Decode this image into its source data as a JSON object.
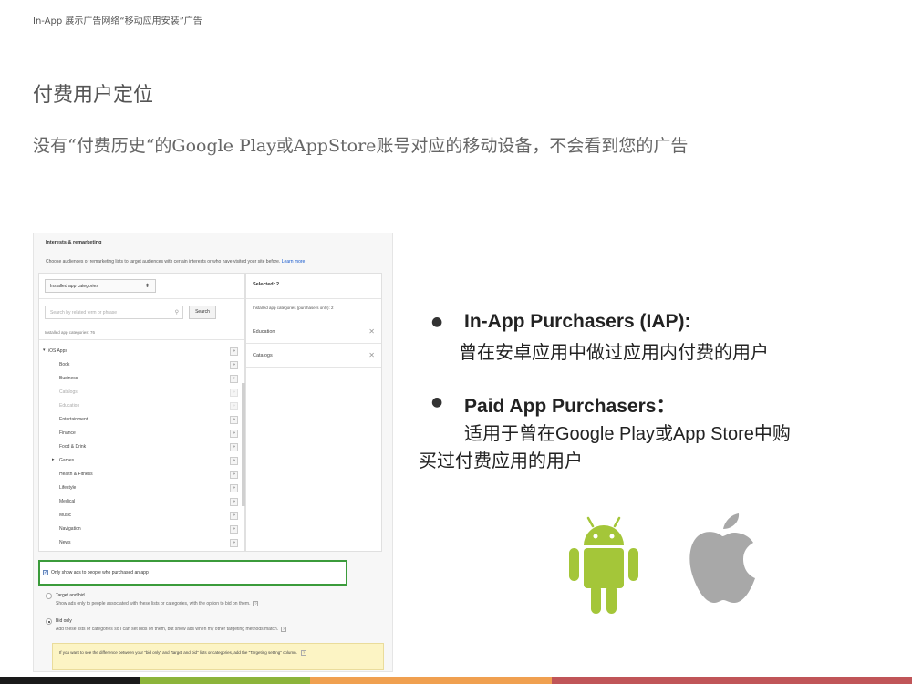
{
  "header": {
    "text": "In-App 展示广告网络“移动应用安装”广告"
  },
  "title": "付费用户定位",
  "subtitle": "没有“付费历史“的Google Play或AppStore账号对应的移动设备，不会看到您的广告",
  "panel": {
    "title": "Interests & remarketing",
    "description": "Choose audiences or remarketing lists to target audiences with certain interests or who have visited your site before.",
    "learn_more": "Learn more",
    "dropdown_value": "Installed app categories",
    "search_placeholder": "Search by related term or phrase",
    "search_button": "Search",
    "category_count": "Installed app categories: 76",
    "categories": [
      {
        "label": "iOS Apps",
        "level": "top",
        "arrow": "▾",
        "disabled": false
      },
      {
        "label": "Book",
        "level": "sub",
        "disabled": false
      },
      {
        "label": "Business",
        "level": "sub",
        "disabled": false
      },
      {
        "label": "Catalogs",
        "level": "sub",
        "disabled": true
      },
      {
        "label": "Education",
        "level": "sub",
        "disabled": true
      },
      {
        "label": "Entertainment",
        "level": "sub",
        "disabled": false
      },
      {
        "label": "Finance",
        "level": "sub",
        "disabled": false
      },
      {
        "label": "Food & Drink",
        "level": "sub",
        "disabled": false
      },
      {
        "label": "Games",
        "level": "sub",
        "arrow": "▸",
        "disabled": false
      },
      {
        "label": "Health & Fitness",
        "level": "sub",
        "disabled": false
      },
      {
        "label": "Lifestyle",
        "level": "sub",
        "disabled": false
      },
      {
        "label": "Medical",
        "level": "sub",
        "disabled": false
      },
      {
        "label": "Music",
        "level": "sub",
        "disabled": false
      },
      {
        "label": "Navigation",
        "level": "sub",
        "disabled": false
      },
      {
        "label": "News",
        "level": "sub",
        "disabled": false
      }
    ],
    "add_symbol": "»",
    "selected_header": "Selected: 2",
    "selected_sub": "Installed app categories (purchasers only): 2",
    "selected_items": [
      "Education",
      "Catalogs"
    ],
    "remove_symbol": "✕",
    "checkbox_label": "Only show ads to people who purchased an app",
    "checkbox_checked": true,
    "radio_target": {
      "label": "Target and bid",
      "desc": "Show ads only to people associated with these lists or categories, with the option to bid on them.",
      "selected": false
    },
    "radio_bid": {
      "label": "Bid only",
      "desc": "Add these lists or categories so I can set bids on them, but show ads when my other targeting methods match.",
      "selected": true
    },
    "help_symbol": "?",
    "note_text": "If you want to see the difference between your \"bid only\" and \"target and bid\" lists or categories, add the \"Targeting setting\" column."
  },
  "bullets": [
    {
      "title": "In-App Purchasers (IAP):",
      "text": "曾在安卓应用中做过应用内付费的用户"
    },
    {
      "title": "Paid App Purchasers：",
      "text_line1": "适用于曾在Google Play或App Store中购",
      "text_line2": "买过付费应用的用户"
    }
  ],
  "icons": {
    "android": "android-logo",
    "apple": "apple-logo"
  },
  "colors": {
    "android_green": "#a4c639",
    "apple_gray": "#a8a8a8",
    "highlight_green": "#3b9b3b",
    "footer": [
      "#1a1a1a",
      "#8cb43a",
      "#f0a050",
      "#c05558"
    ]
  }
}
